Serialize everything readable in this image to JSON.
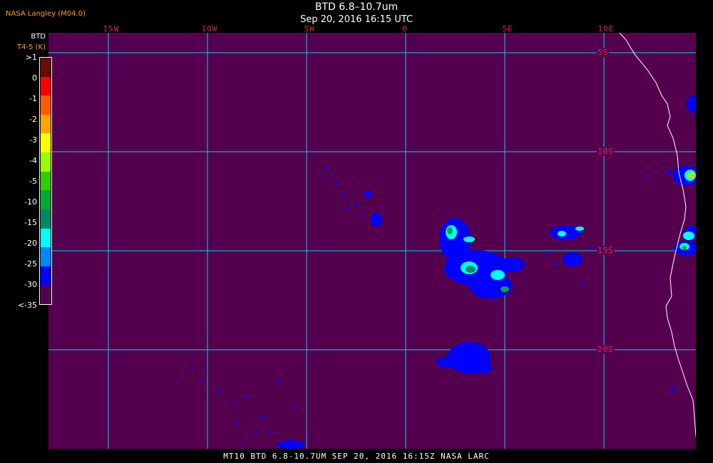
{
  "header": {
    "credit": "NASA Langley (M04.0)",
    "title": "BTD 6.8–10.7um",
    "date": "Sep 20, 2016 16:15 UTC"
  },
  "map": {
    "background_color": "#55004f",
    "grid_color": "#00e5ff",
    "lon_labels": [
      "15W",
      "10W",
      "5W",
      "0",
      "5E",
      "10E"
    ],
    "lat_labels": [
      "5S",
      "10S",
      "15S",
      "20S"
    ]
  },
  "legend": {
    "title": "BTD",
    "subtitle": "T4-5 (K)",
    "bins": [
      {
        "label": ">1",
        "color": "#6a0a0a"
      },
      {
        "label": "0",
        "color": "#ff0000"
      },
      {
        "label": "-1",
        "color": "#ff5a00"
      },
      {
        "label": "-2",
        "color": "#ffa500"
      },
      {
        "label": "-3",
        "color": "#ffff00"
      },
      {
        "label": "-4",
        "color": "#99ff00"
      },
      {
        "label": "-5",
        "color": "#33cc00"
      },
      {
        "label": "-10",
        "color": "#00aa33"
      },
      {
        "label": "-15",
        "color": "#008866"
      },
      {
        "label": "-20",
        "color": "#00ffff"
      },
      {
        "label": "-25",
        "color": "#0088ff"
      },
      {
        "label": "-30",
        "color": "#0000ff"
      },
      {
        "label": "<-35",
        "color": "#55004f"
      }
    ]
  },
  "footer": {
    "text": "MT10  BTD 6.8-10.7UM   SEP 20, 2016 16:15Z   NASA LARC"
  }
}
